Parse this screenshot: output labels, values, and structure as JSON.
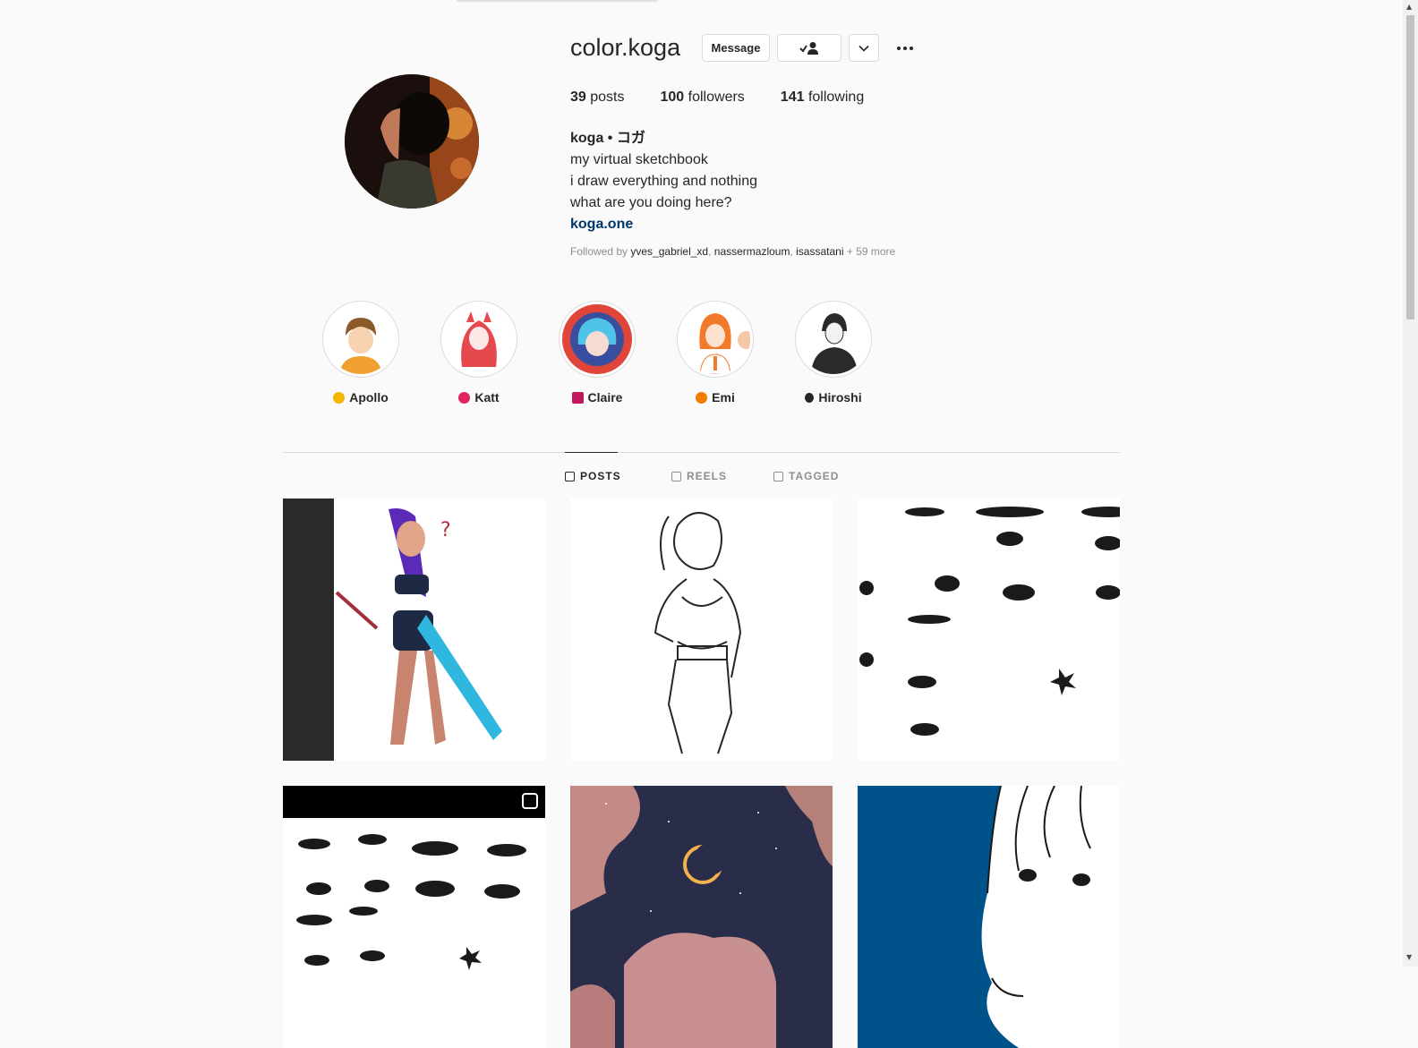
{
  "profile": {
    "username": "color.koga",
    "buttons": {
      "message": "Message"
    },
    "stats": {
      "posts_count": "39",
      "posts_label": "posts",
      "followers_count": "100",
      "followers_label": "followers",
      "following_count": "141",
      "following_label": "following"
    },
    "bio": {
      "name": "koga • コガ",
      "lines": [
        "my virtual sketchbook",
        "i draw everything and nothing",
        "what are you doing here?"
      ],
      "link": "koga.one"
    },
    "followed_by": {
      "prefix": "Followed by",
      "users": [
        "yves_gabriel_xd",
        "nassermazloum",
        "isassatani"
      ],
      "more": "+ 59 more"
    }
  },
  "highlights": [
    {
      "label": "Apollo",
      "emoji_color": "#f5b400"
    },
    {
      "label": "Katt",
      "emoji_color": "#e0245e"
    },
    {
      "label": "Claire",
      "emoji_color": "#c2185b"
    },
    {
      "label": "Emi",
      "emoji_color": "#f57c00"
    },
    {
      "label": "Hiroshi",
      "emoji_color": "#262626"
    }
  ],
  "tabs": [
    {
      "label": "POSTS",
      "active": true
    },
    {
      "label": "REELS",
      "active": false
    },
    {
      "label": "TAGGED",
      "active": false
    }
  ],
  "colors": {
    "link": "#00376b",
    "post_blue_bg": "#00528a",
    "night_sky": "#2a2d4a"
  }
}
